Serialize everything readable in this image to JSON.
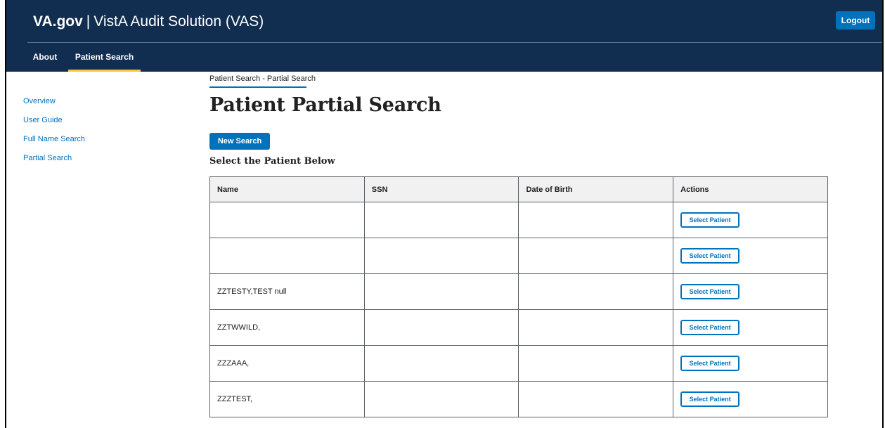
{
  "header": {
    "brand_va": "VA.gov",
    "brand_sep": "|",
    "brand_app": "VistA Audit Solution (VAS)",
    "logout_label": "Logout"
  },
  "nav": {
    "items": [
      {
        "label": "About"
      },
      {
        "label": "Patient Search",
        "active": true
      }
    ]
  },
  "sidebar": {
    "items": [
      {
        "label": "Overview"
      },
      {
        "label": "User Guide"
      },
      {
        "label": "Full Name Search"
      },
      {
        "label": "Partial Search"
      }
    ]
  },
  "main": {
    "breadcrumb": "Patient Search - Partial Search",
    "title": "Patient Partial Search",
    "new_search_label": "New Search",
    "section_title": "Select the Patient Below",
    "table": {
      "headers": [
        "Name",
        "SSN",
        "Date of Birth",
        "Actions"
      ],
      "rows": [
        {
          "name": "",
          "ssn": "",
          "dob": "",
          "action": "Select Patient"
        },
        {
          "name": "",
          "ssn": "",
          "dob": "",
          "action": "Select Patient"
        },
        {
          "name": "ZZTESTY,TEST null",
          "ssn": "",
          "dob": "",
          "action": "Select Patient"
        },
        {
          "name": "ZZTWWILD,",
          "ssn": "",
          "dob": "",
          "action": "Select Patient"
        },
        {
          "name": "ZZZAAA,",
          "ssn": "",
          "dob": "",
          "action": "Select Patient"
        },
        {
          "name": "ZZZTEST,",
          "ssn": "",
          "dob": "",
          "action": "Select Patient"
        }
      ]
    }
  },
  "colors": {
    "header_bg": "#112e51",
    "accent_blue": "#0071bb",
    "nav_active_underline": "#f9c642"
  }
}
